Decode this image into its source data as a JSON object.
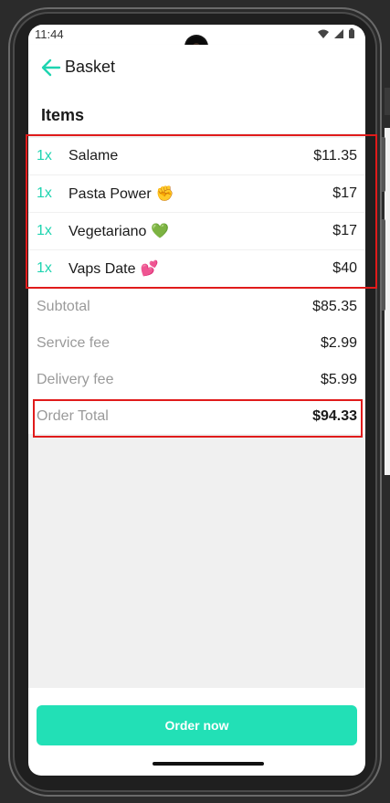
{
  "status_bar": {
    "time": "11:44",
    "icons": [
      "wifi-icon",
      "signal-icon",
      "battery-icon"
    ]
  },
  "app_bar": {
    "back_icon": "arrow-left-icon",
    "title": "Basket"
  },
  "items_section": {
    "title": "Items"
  },
  "items": [
    {
      "qty": "1x",
      "name": "Salame",
      "emoji": "",
      "price": "$11.35"
    },
    {
      "qty": "1x",
      "name": "Pasta Power",
      "emoji": "✊",
      "price": "$17"
    },
    {
      "qty": "1x",
      "name": "Vegetariano",
      "emoji": "💚",
      "price": "$17"
    },
    {
      "qty": "1x",
      "name": "Vaps Date",
      "emoji": "💕",
      "price": "$40"
    }
  ],
  "summary": {
    "subtotal": {
      "label": "Subtotal",
      "value": "$85.35"
    },
    "service_fee": {
      "label": "Service fee",
      "value": "$2.99"
    },
    "delivery_fee": {
      "label": "Delivery fee",
      "value": "$5.99"
    },
    "order_total": {
      "label": "Order Total",
      "value": "$94.33"
    }
  },
  "footer": {
    "order_button": "Order now"
  },
  "colors": {
    "accent": "#22e0b6",
    "quantity": "#1ed4b0",
    "highlight": "#e01b1b"
  }
}
